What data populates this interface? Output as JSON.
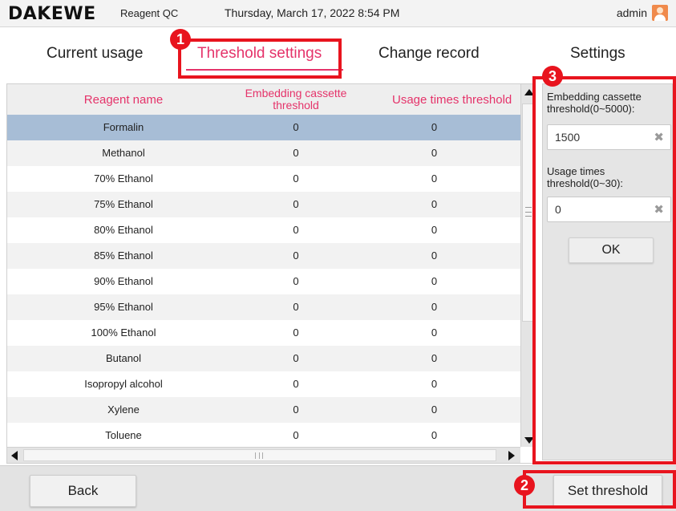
{
  "header": {
    "brand": "DAKEWE",
    "app_title": "Reagent QC",
    "datetime": "Thursday, March 17, 2022 8:54 PM",
    "user": "admin",
    "avatar_icon": "user-avatar-icon"
  },
  "tabs": [
    {
      "label": "Current usage",
      "active": false
    },
    {
      "label": "Threshold settings",
      "active": true
    },
    {
      "label": "Change record",
      "active": false
    },
    {
      "label": "Settings",
      "active": false
    }
  ],
  "table": {
    "columns": [
      "Reagent name",
      "Embedding cassette threshold",
      "Usage times threshold"
    ],
    "rows": [
      {
        "name": "Formalin",
        "embed": "0",
        "usage": "0",
        "selected": true
      },
      {
        "name": "Methanol",
        "embed": "0",
        "usage": "0"
      },
      {
        "name": "70% Ethanol",
        "embed": "0",
        "usage": "0"
      },
      {
        "name": "75% Ethanol",
        "embed": "0",
        "usage": "0"
      },
      {
        "name": "80% Ethanol",
        "embed": "0",
        "usage": "0"
      },
      {
        "name": "85% Ethanol",
        "embed": "0",
        "usage": "0"
      },
      {
        "name": "90% Ethanol",
        "embed": "0",
        "usage": "0"
      },
      {
        "name": "95% Ethanol",
        "embed": "0",
        "usage": "0"
      },
      {
        "name": "100% Ethanol",
        "embed": "0",
        "usage": "0"
      },
      {
        "name": "Butanol",
        "embed": "0",
        "usage": "0"
      },
      {
        "name": "Isopropyl alcohol",
        "embed": "0",
        "usage": "0"
      },
      {
        "name": "Xylene",
        "embed": "0",
        "usage": "0"
      },
      {
        "name": "Toluene",
        "embed": "0",
        "usage": "0"
      }
    ]
  },
  "panel": {
    "embed_label": "Embedding cassette threshold(0~5000):",
    "embed_value": "1500",
    "usage_label": "Usage times threshold(0~30):",
    "usage_value": "0",
    "clear_glyph": "✖",
    "ok_label": "OK"
  },
  "footer": {
    "back_label": "Back",
    "set_label": "Set threshold"
  },
  "annotations": {
    "badge1": "1",
    "badge2": "2",
    "badge3": "3"
  },
  "colors": {
    "accent": "#e5336a",
    "annotation_red": "#e8141e",
    "selected_row": "#a7bdd6"
  }
}
